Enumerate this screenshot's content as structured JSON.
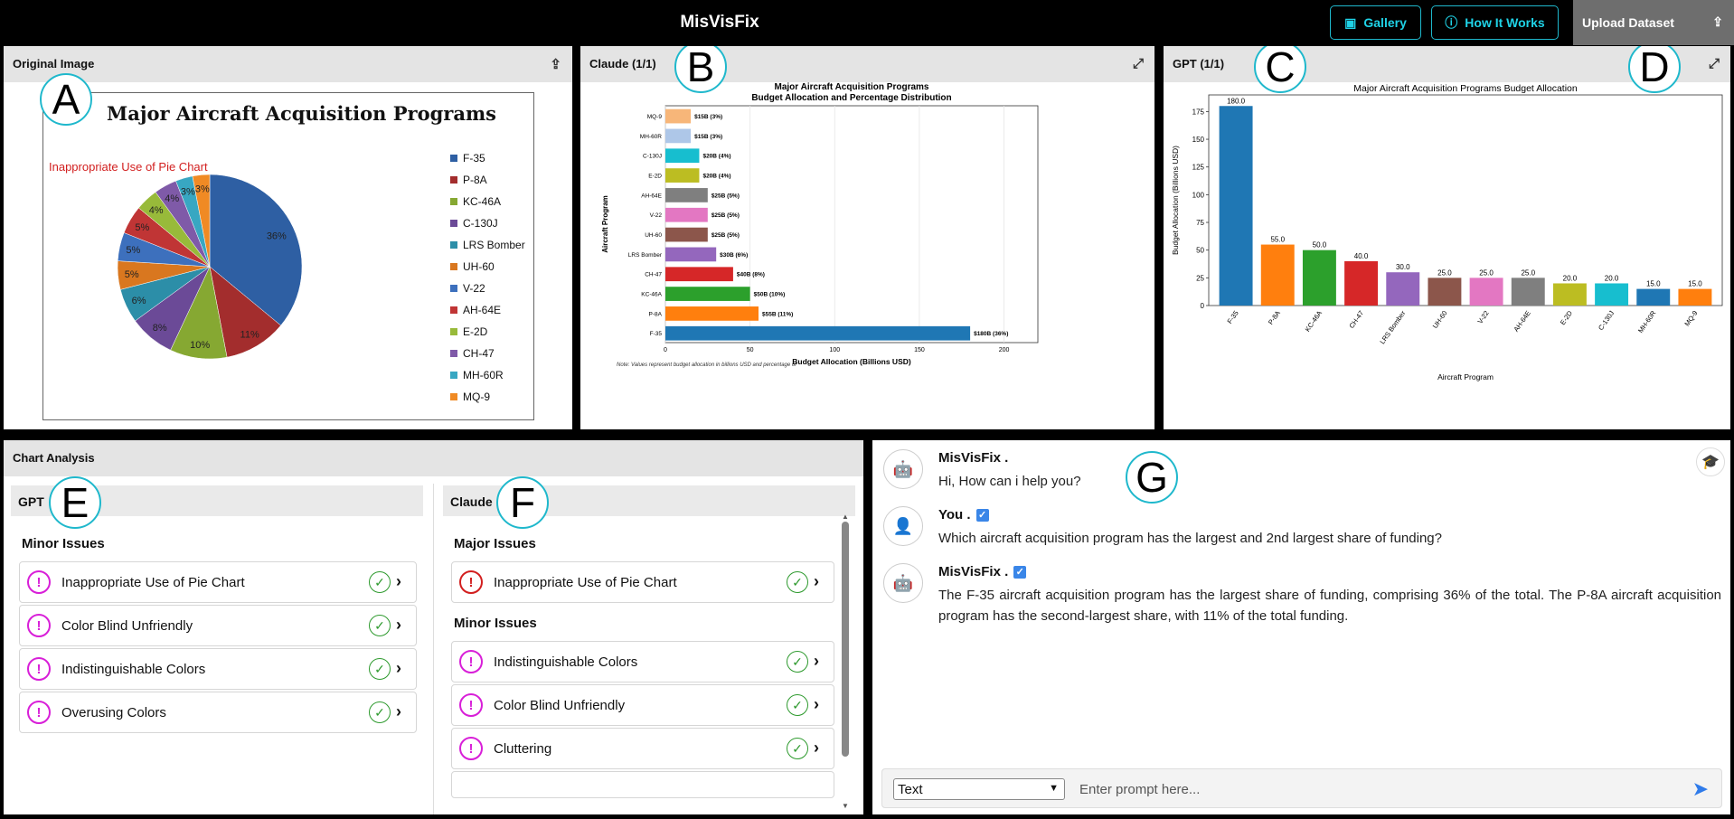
{
  "header": {
    "app_title": "MisVisFix",
    "gallery_label": "Gallery",
    "how_label": "How It Works",
    "upload_label": "Upload Dataset"
  },
  "panels": {
    "original_title": "Original Image",
    "claude_title": "Claude (1/1)",
    "gpt_title": "GPT (1/1)",
    "analysis_title": "Chart Analysis"
  },
  "markers": {
    "a": "A",
    "b": "B",
    "c": "C",
    "d": "D",
    "e": "E",
    "f": "F",
    "g": "G"
  },
  "original": {
    "title": "Major Aircraft Acquisition Programs",
    "annotation": "Inappropriate Use of Pie Chart"
  },
  "chart_data": [
    {
      "type": "pie",
      "title": "Major Aircraft Acquisition Programs",
      "labels": [
        "F-35",
        "P-8A",
        "KC-46A",
        "C-130J",
        "LRS Bomber",
        "UH-60",
        "V-22",
        "AH-64E",
        "E-2D",
        "CH-47",
        "MH-60R",
        "MQ-9"
      ],
      "slices": [
        {
          "label": "F-35",
          "value": 36,
          "text": "36%",
          "color": "#2e5fa3"
        },
        {
          "label": "P-8A",
          "value": 11,
          "text": "11%",
          "color": "#a32d2d"
        },
        {
          "label": "KC-46A",
          "value": 10,
          "text": "10%",
          "color": "#86a832"
        },
        {
          "label": "C-130J",
          "value": 8,
          "text": "8%",
          "color": "#6b4a97"
        },
        {
          "label": "LRS Bomber",
          "value": 6,
          "text": "6%",
          "color": "#2c8ea8"
        },
        {
          "label": "UH-60",
          "value": 5,
          "text": "5%",
          "color": "#d9771f"
        },
        {
          "label": "V-22",
          "value": 5,
          "text": "5%",
          "color": "#3d70bd"
        },
        {
          "label": "AH-64E",
          "value": 5,
          "text": "5%",
          "color": "#c03535"
        },
        {
          "label": "E-2D",
          "value": 4,
          "text": "4%",
          "color": "#98ba3a"
        },
        {
          "label": "CH-47",
          "value": 4,
          "text": "4%",
          "color": "#7f5aa8"
        },
        {
          "label": "MH-60R",
          "value": 3,
          "text": "3%",
          "color": "#38a7c2"
        },
        {
          "label": "MQ-9",
          "value": 3,
          "text": "3%",
          "color": "#f08a24"
        }
      ]
    },
    {
      "type": "bar",
      "orientation": "horizontal",
      "title": "Major Aircraft Acquisition Programs",
      "subtitle": "Budget Allocation and Percentage Distribution",
      "xlabel": "Budget Allocation (Billions USD)",
      "ylabel": "Aircraft Program",
      "xlim": [
        0,
        220
      ],
      "xticks": [
        0,
        50,
        100,
        150,
        200
      ],
      "note": "Note: Values represent budget allocation in billions USD and percentage of",
      "categories": [
        "MQ-9",
        "MH-60R",
        "C-130J",
        "E-2D",
        "AH-64E",
        "V-22",
        "UH-60",
        "LRS Bomber",
        "CH-47",
        "KC-46A",
        "P-8A",
        "F-35"
      ],
      "values": [
        15,
        15,
        20,
        20,
        25,
        25,
        25,
        30,
        40,
        50,
        55,
        180
      ],
      "labels": [
        "$15B (3%)",
        "$15B (3%)",
        "$20B (4%)",
        "$20B (4%)",
        "$25B (5%)",
        "$25B (5%)",
        "$25B (5%)",
        "$30B (6%)",
        "$40B (8%)",
        "$50B (10%)",
        "$55B (11%)",
        "$180B (36%)"
      ],
      "colors": [
        "#f7b679",
        "#aec7e8",
        "#17becf",
        "#bcbd22",
        "#7f7f7f",
        "#e377c2",
        "#8c564b",
        "#9467bd",
        "#d62728",
        "#2ca02c",
        "#ff7f0e",
        "#1f77b4"
      ]
    },
    {
      "type": "bar",
      "title": "Major Aircraft Acquisition Programs Budget Allocation",
      "xlabel": "Aircraft Program",
      "ylabel": "Budget Allocation (Billions USD)",
      "ylim": [
        0,
        190
      ],
      "yticks": [
        0,
        25,
        50,
        75,
        100,
        125,
        150,
        175
      ],
      "categories": [
        "F-35",
        "P-8A",
        "KC-46A",
        "CH-47",
        "LRS Bomber",
        "UH-60",
        "V-22",
        "AH-64E",
        "E-2D",
        "C-130J",
        "MH-60R",
        "MQ-9"
      ],
      "values": [
        180,
        55,
        50,
        40,
        30,
        25,
        25,
        25,
        20,
        20,
        15,
        15
      ],
      "labels": [
        "180.0",
        "55.0",
        "50.0",
        "40.0",
        "30.0",
        "25.0",
        "25.0",
        "25.0",
        "20.0",
        "20.0",
        "15.0",
        "15.0"
      ],
      "colors": [
        "#1f77b4",
        "#ff7f0e",
        "#2ca02c",
        "#d62728",
        "#9467bd",
        "#8c564b",
        "#e377c2",
        "#7f7f7f",
        "#bcbd22",
        "#17becf",
        "#1f77b4",
        "#ff7f0e"
      ]
    }
  ],
  "analysis": {
    "gpt": {
      "header": "GPT",
      "minor_title": "Minor Issues",
      "minor": [
        "Inappropriate Use of Pie Chart",
        "Color Blind Unfriendly",
        "Indistinguishable Colors",
        "Overusing Colors"
      ]
    },
    "claude": {
      "header": "Claude",
      "major_title": "Major Issues",
      "major": [
        "Inappropriate Use of Pie Chart"
      ],
      "minor_title": "Minor Issues",
      "minor": [
        "Indistinguishable Colors",
        "Color Blind Unfriendly",
        "Cluttering"
      ]
    }
  },
  "chat": {
    "messages": [
      {
        "name": "MisVisFix .",
        "text": "Hi, How can i help you?"
      },
      {
        "name": "You .",
        "text": "Which aircraft acquisition program has the largest and 2nd largest share of funding?"
      },
      {
        "name": "MisVisFix .",
        "text": "The F-35 aircraft acquisition program has the largest share of funding, comprising 36% of the total. The P-8A aircraft acquisition program has the second-largest share, with 11% of the total funding."
      }
    ],
    "mode_value": "Text",
    "prompt_placeholder": "Enter prompt here..."
  }
}
